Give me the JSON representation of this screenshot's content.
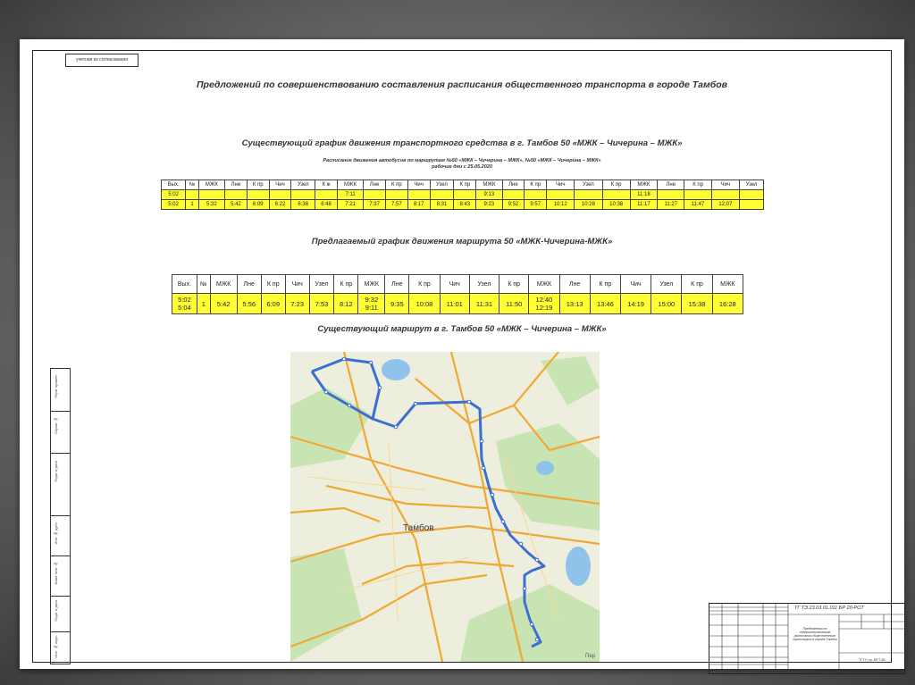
{
  "sheet": {
    "corner_stamp": "учетная из согласования",
    "title": "Предложений по совершенствованию составления расписания общественного транспорта в городе Тамбов",
    "existing_schedule_title": "Существующий график движения транспортного средства в г. Тамбов 50 «МЖК – Чичерина – МЖК»",
    "existing_schedule_caption": "Расписание движения автобусов по маршрутам №50 «МЖК – Чичерина – МЖК», №50 «МЖК – Чичерина – МЖК»",
    "existing_schedule_note": "рабочие дни с 25.05.2020",
    "proposed_schedule_title": "Предлагаемый график движения маршрута 50 «МЖК-Чичерина-МЖК»",
    "route_map_title": "Существующий маршрут в г. Тамбов 50 «МЖК – Чичерина – МЖК»"
  },
  "table_existing": {
    "header": [
      "Вых.",
      "№",
      "МЖК",
      "Лне",
      "К пр",
      "Чич",
      "Узел",
      "К ж",
      "МЖК",
      "Лне",
      "К пр",
      "Чич",
      "Узел",
      "К пр",
      "МЖК",
      "Лне",
      "К пр",
      "Чич",
      "Узел",
      "К пр",
      "МЖК",
      "Лне",
      "К пр",
      "Чич",
      "Узел"
    ],
    "row1": [
      "5:02",
      "",
      "",
      "",
      "",
      "",
      "",
      "",
      "7:11",
      "",
      "",
      "",
      "",
      "",
      "9:13",
      "",
      "",
      "",
      "",
      "",
      "11:18",
      "",
      "",
      "",
      ""
    ],
    "row2": [
      "5:02",
      "1",
      "5:32",
      "5:42",
      "6:09",
      "6:22",
      "6:36",
      "6:48",
      "7:21",
      "7:37",
      "7:57",
      "8:17",
      "8:31",
      "8:43",
      "9:23",
      "9:52",
      "9:57",
      "10:12",
      "10:28",
      "10:38",
      "11:17",
      "11:27",
      "11:47",
      "12:07",
      ""
    ]
  },
  "table_proposed": {
    "header": [
      "Вых.",
      "№",
      "МЖК",
      "Лне",
      "К пр",
      "Чич",
      "Узел",
      "К пр",
      "МЖК",
      "Лне",
      "К пр",
      "Чич",
      "Узел",
      "К пр",
      "МЖК",
      "Лне",
      "К пр",
      "Чич",
      "Узел",
      "К пр",
      "МЖК"
    ],
    "row_top": [
      "5:02",
      "",
      "",
      "",
      "",
      "",
      "",
      "",
      "9:32",
      "",
      "",
      "",
      "",
      "",
      "12:40",
      "",
      "",
      "",
      "",
      "",
      "16:28"
    ],
    "row_bot": [
      "5:04",
      "1",
      "5:42",
      "5:56",
      "6:09",
      "7:23",
      "7:53",
      "8:12",
      "9:11",
      "9:35",
      "10:08",
      "11:01",
      "11:31",
      "11:50",
      "12:19",
      "13:13",
      "13:46",
      "14:19",
      "15:00",
      "15:38",
      ""
    ]
  },
  "map": {
    "city_label": "Тамбов",
    "corner_label": "Пер"
  },
  "left_strip": {
    "labels": [
      "Перв. примен.",
      "Справ. №",
      "Подп. и дата",
      "Инв. № дубл.",
      "Взам. инв. №",
      "Подп. и дата",
      "Инв. № подл."
    ]
  },
  "stamp": {
    "code": "ТГ ТЭ.23.03.01.011 БР 20-РОТ",
    "name": "Предложения по совершенствованию расписания общественного транспорта в городе Тамбов",
    "university": "ТГТУ, гр. ВТТ-81"
  },
  "colors": {
    "highlight": "#ffff33",
    "route": "#3b6fd1",
    "roads": "#f0a833",
    "water": "#8fc3ea",
    "parks": "#c9e4b3"
  }
}
